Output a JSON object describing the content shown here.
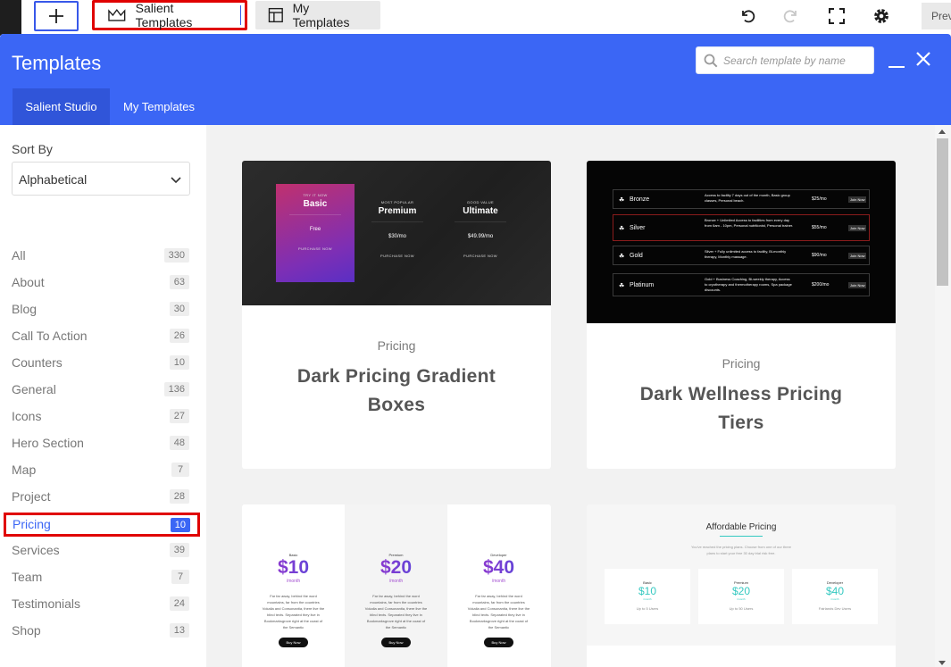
{
  "toolbar": {
    "salient_templates_label": "Salient Templates",
    "my_templates_label": "My Templates",
    "preview_label": "Preview"
  },
  "modal": {
    "title": "Templates",
    "search_placeholder": "Search template by name",
    "tabs": [
      {
        "label": "Salient Studio",
        "active": true
      },
      {
        "label": "My Templates",
        "active": false
      }
    ]
  },
  "sidebar": {
    "sort_label": "Sort By",
    "sort_value": "Alphabetical",
    "categories": [
      {
        "label": "All",
        "count": "330"
      },
      {
        "label": "About",
        "count": "63"
      },
      {
        "label": "Blog",
        "count": "30"
      },
      {
        "label": "Call To Action",
        "count": "26"
      },
      {
        "label": "Counters",
        "count": "10"
      },
      {
        "label": "General",
        "count": "136"
      },
      {
        "label": "Icons",
        "count": "27"
      },
      {
        "label": "Hero Section",
        "count": "48"
      },
      {
        "label": "Map",
        "count": "7"
      },
      {
        "label": "Project",
        "count": "28"
      },
      {
        "label": "Pricing",
        "count": "10"
      },
      {
        "label": "Services",
        "count": "39"
      },
      {
        "label": "Team",
        "count": "7"
      },
      {
        "label": "Testimonials",
        "count": "24"
      },
      {
        "label": "Shop",
        "count": "13"
      }
    ]
  },
  "cards": [
    {
      "category": "Pricing",
      "title_line1": "Dark Pricing Gradient",
      "title_line2": "Boxes",
      "thumb": {
        "plans": [
          {
            "kicker": "TRY IT NOW",
            "name": "Basic",
            "price": "Free",
            "cta": "PURCHASE NOW"
          },
          {
            "kicker": "MOST POPULAR",
            "name": "Premium",
            "price": "$30/mo",
            "cta": "PURCHASE NOW"
          },
          {
            "kicker": "GOOD VALUE",
            "name": "Ultimate",
            "price": "$49.99/mo",
            "cta": "PURCHASE NOW"
          }
        ]
      }
    },
    {
      "category": "Pricing",
      "title_line1": "Dark Wellness Pricing",
      "title_line2": "Tiers",
      "thumb": {
        "tiers": [
          {
            "name": "Bronze",
            "desc": "Access to facility 7 days out of the month, Basic group classes, Personal beach.",
            "price": "$25/mo",
            "cta": "Join Now"
          },
          {
            "name": "Silver",
            "desc": "Bronze + Unlimited Access to facilities from every day from 6am - 10pm, Personal nutritionist, Personal trainer.",
            "price": "$55/mo",
            "cta": "Join Now"
          },
          {
            "name": "Gold",
            "desc": "Silver + Fully unlimited access to facility, Bi-monthly therapy, Monthly massage.",
            "price": "$90/mo",
            "cta": "Join Now"
          },
          {
            "name": "Platinum",
            "desc": "Gold + Business Coaching, Bi-weekly therapy, Access to cryotherapy and thermotherapy rooms, Spa package discounts.",
            "price": "$200/mo",
            "cta": "Join Now"
          }
        ]
      }
    },
    {
      "thumb": {
        "plans": [
          {
            "name": "Basic",
            "price": "$10",
            "period": "/month",
            "cta": "Buy Now"
          },
          {
            "name": "Premium",
            "price": "$20",
            "period": "/month",
            "cta": "Buy Now"
          },
          {
            "name": "Developer",
            "price": "$40",
            "period": "/month",
            "cta": "Buy Now"
          }
        ],
        "blurb": "Far far away, behind the word mountains, far from the countries Vokalia and Consonantia, there live the blind texts. Separated they live in Bookmarksgrove right at the coast of the Semantic"
      }
    },
    {
      "thumb": {
        "heading": "Affordable Pricing",
        "subtext": "You've reached the pricing plans. Choose from one of our three plans to start your free 30 day trial risk free.",
        "plans": [
          {
            "name": "Basic",
            "price": "$10",
            "period": "/month",
            "cta": "Up to 5 Users"
          },
          {
            "name": "Premium",
            "price": "$20",
            "period": "/month",
            "cta": "Up to 50 Users"
          },
          {
            "name": "Developer",
            "price": "$40",
            "period": "/month",
            "cta": "Fairlands Dev Users"
          }
        ]
      }
    }
  ],
  "colors": {
    "header_blue": "#3b66f5",
    "tab_active": "#3055d9",
    "highlight_red": "#e00000",
    "accent_teal": "#35c9c1"
  }
}
